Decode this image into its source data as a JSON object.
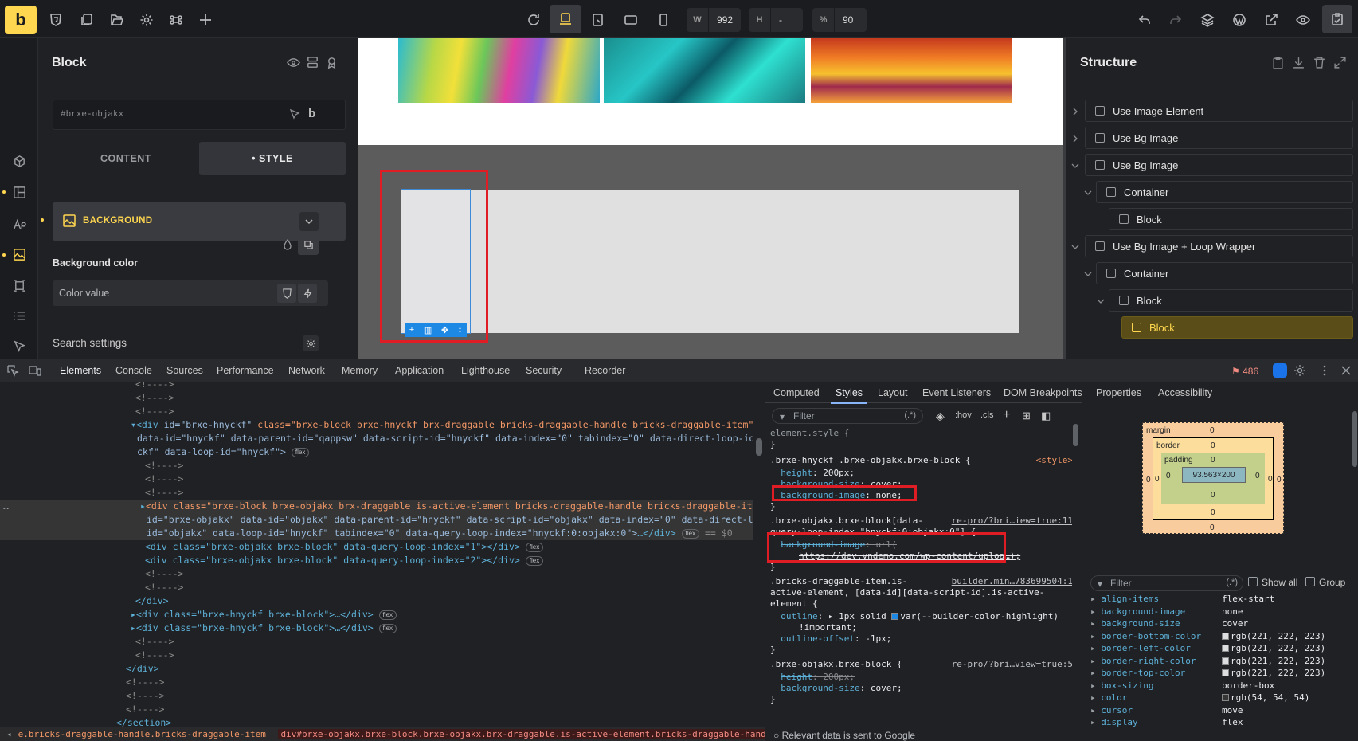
{
  "app": {
    "logo_letter": "b"
  },
  "topbar": {
    "width_label": "W",
    "width_value": "992",
    "height_label": "H",
    "height_value": "-",
    "zoom_label": "%",
    "zoom_value": "90"
  },
  "left_panel": {
    "title": "Block",
    "element_id": "#brxe-objakx",
    "tabs": {
      "content": "CONTENT",
      "style": "• STYLE"
    },
    "section": "BACKGROUND",
    "bg_color_label": "Background color",
    "color_placeholder": "Color value",
    "search_settings": "Search settings"
  },
  "structure": {
    "title": "Structure",
    "items": [
      {
        "label": "Use Image Element"
      },
      {
        "label": "Use Bg Image"
      },
      {
        "label": "Use Bg Image"
      },
      {
        "label": "Container"
      },
      {
        "label": "Block"
      },
      {
        "label": "Use Bg Image + Loop Wrapper"
      },
      {
        "label": "Container"
      },
      {
        "label": "Block"
      },
      {
        "label": "Block"
      }
    ]
  },
  "devtools": {
    "tabs": [
      "Elements",
      "Console",
      "Sources",
      "Performance",
      "Network",
      "Memory",
      "Application",
      "Lighthouse",
      "Security",
      "Recorder"
    ],
    "issue_count": "486",
    "side_tabs": [
      "Computed",
      "Styles",
      "Layout",
      "Event Listeners",
      "DOM Breakpoints",
      "Properties",
      "Accessibility"
    ],
    "filter_placeholder": "Filter",
    "filter_toggles": {
      "regex": "(.*)",
      "hov": ":hov",
      "cls": ".cls"
    },
    "elements": {
      "l0": "<!---->",
      "l1": "<!---->",
      "l2": "<!---->",
      "l3a": "<div ",
      "l3_id": "id=\"brxe-hnyckf\" ",
      "l3_class": "class=\"brxe-block brxe-hnyckf brx-draggable bricks-draggable-handle bricks-draggable-item\"",
      "l4": "data-id=\"hnyckf\" data-parent-id=\"qappsw\" data-script-id=\"hnyckf\" data-index=\"0\" tabindex=\"0\" data-direct-loop-id=\"hny",
      "l5": "ckf\" data-loop-id=\"hnyckf\">",
      "flex": "flex",
      "l6": "<!---->",
      "l7": "<!---->",
      "l8": "<!---->",
      "l9": "<div class=\"brxe-block brxe-objakx brx-draggable is-active-element bricks-draggable-handle bricks-draggable-item\"",
      "l10": "id=\"brxe-objakx\" data-id=\"objakx\" data-parent-id=\"hnyckf\" data-script-id=\"objakx\" data-index=\"0\" data-direct-loop-",
      "l11": "id=\"objakx\" data-loop-id=\"hnyckf\" tabindex=\"0\" data-query-loop-index=\"hnyckf:0:objakx:0\">",
      "l11_tail": "</div>",
      "l11_eq": " == $0",
      "l12": "<div class=\"brxe-objakx brxe-block\" data-query-loop-index=\"1\"></div>",
      "l13": "<div class=\"brxe-objakx brxe-block\" data-query-loop-index=\"2\"></div>",
      "l14": "<!---->",
      "l15": "<!---->",
      "l16": "</div>",
      "l17": "<div class=\"brxe-hnyckf brxe-block\">",
      "l17_tail": "</div>",
      "l18": "<div class=\"brxe-hnyckf brxe-block\">",
      "l18_tail": "</div>",
      "l19": "<!---->",
      "l20": "<!---->",
      "l21": "</div>",
      "l22": "<!---->",
      "l23": "<!---->",
      "l24": "<!---->",
      "l25": "</section>"
    },
    "breadcrumb": {
      "a": "e.bricks-draggable-handle.bricks-draggable-item",
      "b": "div#brxe-objakx.brxe-block.brxe-objakx.brx-draggable.is-active-element.bricks-draggable-handle.bricks-draggable-item"
    },
    "styles": {
      "r0": "element.style {",
      "r1": "}",
      "r2": ".brxe-hnyckf .brxe-objakx.brxe-block {",
      "r2_src": "<style>",
      "r3_p": "height",
      "r3_v": "200px;",
      "r4_p": "background-size",
      "r4_v": "cover;",
      "r5_p": "background-image",
      "r5_v": "none;",
      "r6": "}",
      "r7": ".brxe-objakx.brxe-block[data-",
      "r7_src": "re-pro/?bri…iew=true:11",
      "r8": "query-loop-index=\"hnyckf:0:objakx:0\"] {",
      "r9_p": "background-image",
      "r9_v": "url(",
      "r10": "https://dev.vndemo.com/wp-content/uploa…);",
      "r11": "}",
      "r12": ".bricks-draggable-item.is-",
      "r12_src": "builder.min…783699504:1",
      "r13": "active-element, [data-id][data-script-id].is-active-",
      "r14": "element {",
      "r15_p": "outline",
      "r15_v": "1px solid",
      "r15_var": "var(--builder-color-highlight)",
      "r16": "!important;",
      "r17_p": "outline-offset",
      "r17_v": "-1px;",
      "r18": "}",
      "r19": ".brxe-objakx.brxe-block {",
      "r19_src": "re-pro/?bri…view=true:5",
      "r20_p": "height",
      "r20_v": "200px;",
      "r21_p": "background-size",
      "r21_v": "cover;",
      "r22": "}"
    },
    "relevant": "Relevant data is sent to Google",
    "boxmodel": {
      "margin": "margin",
      "border": "border",
      "padding": "padding",
      "content": "93.563×200",
      "zero": "0",
      "dash": "-"
    },
    "computed_filter": {
      "placeholder": "Filter",
      "show_all": "Show all",
      "group": "Group"
    },
    "computed": [
      {
        "name": "align-items",
        "value": "flex-start"
      },
      {
        "name": "background-image",
        "value": "none"
      },
      {
        "name": "background-size",
        "value": "cover"
      },
      {
        "name": "border-bottom-color",
        "value": "rgb(221, 222, 223)",
        "swatch": "#dddedf"
      },
      {
        "name": "border-left-color",
        "value": "rgb(221, 222, 223)",
        "swatch": "#dddedf"
      },
      {
        "name": "border-right-color",
        "value": "rgb(221, 222, 223)",
        "swatch": "#dddedf"
      },
      {
        "name": "border-top-color",
        "value": "rgb(221, 222, 223)",
        "swatch": "#dddedf"
      },
      {
        "name": "box-sizing",
        "value": "border-box"
      },
      {
        "name": "color",
        "value": "rgb(54, 54, 54)",
        "swatch": "#363636"
      },
      {
        "name": "cursor",
        "value": "move"
      },
      {
        "name": "display",
        "value": "flex"
      }
    ]
  },
  "colors": {
    "accent": "#ffd64f",
    "highlight": "#1e88e5",
    "annotation": "#e01c24"
  }
}
